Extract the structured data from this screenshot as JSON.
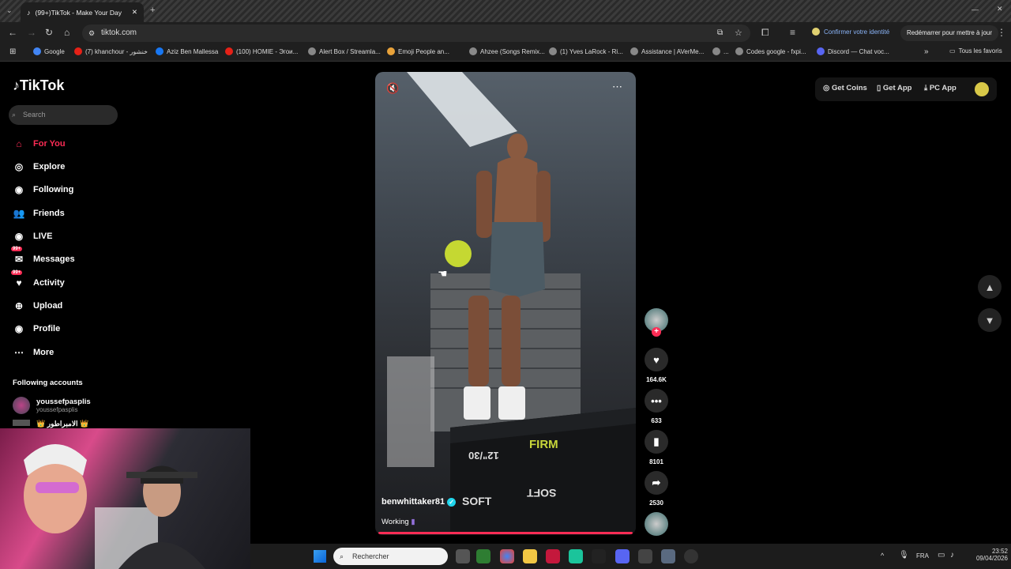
{
  "browser": {
    "tab_title": "(99+)TikTok - Make Your Day",
    "url": "tiktok.com",
    "identity_label": "Confirmer votre identité",
    "restart_label": "Redémarrer pour mettre à jour",
    "all_bookmarks_label": "Tous les favoris",
    "bookmarks": [
      "Google",
      "(7) khanchour - خنشور",
      "Aziz Ben Mallessa",
      "(100) HOMIE - Эгои...",
      "Alert Box / Streamla...",
      "Emoji People an...",
      "Ahzee (Songs Remix...",
      "(1) Yves LaRock - Ri...",
      "Assistance | AVerMe...",
      "...",
      "Codes google - fxpi...",
      "Discord — Chat voc..."
    ]
  },
  "tiktok": {
    "logo": "TikTok",
    "search_placeholder": "Search",
    "nav": [
      "For You",
      "Explore",
      "Following",
      "Friends",
      "LIVE",
      "Messages",
      "Activity",
      "Upload",
      "Profile",
      "More"
    ],
    "badge": "99+",
    "following_title": "Following accounts",
    "accounts": [
      {
        "name": "youssefpasplis",
        "handle": "youssefpasplis"
      },
      {
        "name": "👑 الامبراطور 👑",
        "handle": ""
      }
    ],
    "header": {
      "coins": "Get Coins",
      "app": "Get App",
      "pc": "PC App"
    },
    "video": {
      "author": "benwhittaker81",
      "caption": "Working",
      "likes": "164.6K",
      "comments": "633",
      "saves": "8101",
      "shares": "2530",
      "box_text_1": "FIRM",
      "box_text_2": "SOFT",
      "box_text_3": "SOFT",
      "box_text_4": "12\"/30"
    }
  },
  "taskbar": {
    "search": "Rechercher",
    "lang": "FRA",
    "time": "23:52",
    "date": "09/04/2026"
  },
  "colors": {
    "accent": "#fe2c55",
    "verified": "#20d5ec"
  }
}
